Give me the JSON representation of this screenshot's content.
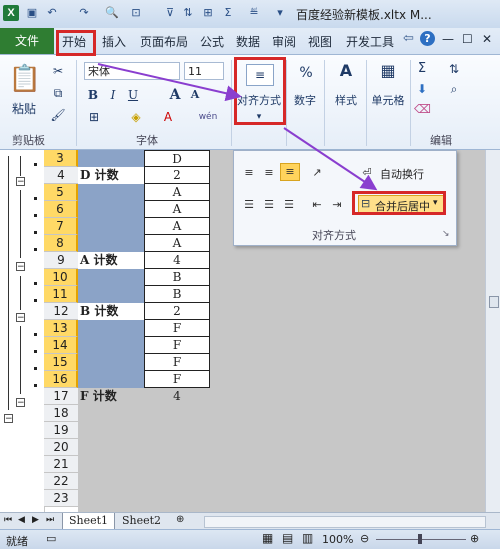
{
  "window": {
    "title": "百度经验新模板.xltx M...",
    "app_logo": "X",
    "controls": [
      "—",
      "☐",
      "✕"
    ]
  },
  "tabs": [
    "文件",
    "开始",
    "插入",
    "页面布局",
    "公式",
    "数据",
    "审阅",
    "视图",
    "开发工具"
  ],
  "ribbon": {
    "clipboard": {
      "paste_label": "粘贴",
      "group_label": "剪贴板"
    },
    "font": {
      "name": "宋体",
      "size": "11",
      "bold": "B",
      "italic": "I",
      "underline": "U",
      "grow": "A",
      "shrink": "A",
      "group_label": "字体",
      "wen": "wén"
    },
    "alignment": {
      "label": "对齐方式"
    },
    "number": {
      "icon": "%",
      "label": "数字"
    },
    "styles": {
      "label": "样式"
    },
    "cells": {
      "label": "单元格"
    },
    "editing": {
      "sigma": "Σ",
      "label": "编辑"
    }
  },
  "align_popup": {
    "wrap_text": "自动换行",
    "merge_center": "合并后居中",
    "group_label": "对齐方式"
  },
  "rows": [
    {
      "num": "3",
      "a": "",
      "b": "D",
      "type": "item"
    },
    {
      "num": "4",
      "a": "D 计数",
      "b": "2",
      "type": "sum"
    },
    {
      "num": "5",
      "a": "",
      "b": "A",
      "type": "item"
    },
    {
      "num": "6",
      "a": "",
      "b": "A",
      "type": "item"
    },
    {
      "num": "7",
      "a": "",
      "b": "A",
      "type": "item"
    },
    {
      "num": "8",
      "a": "",
      "b": "A",
      "type": "item"
    },
    {
      "num": "9",
      "a": "A 计数",
      "b": "4",
      "type": "sum"
    },
    {
      "num": "10",
      "a": "",
      "b": "B",
      "type": "item"
    },
    {
      "num": "11",
      "a": "",
      "b": "B",
      "type": "item"
    },
    {
      "num": "12",
      "a": "B 计数",
      "b": "2",
      "type": "sum"
    },
    {
      "num": "13",
      "a": "",
      "b": "F",
      "type": "item"
    },
    {
      "num": "14",
      "a": "",
      "b": "F",
      "type": "item"
    },
    {
      "num": "15",
      "a": "",
      "b": "F",
      "type": "item"
    },
    {
      "num": "16",
      "a": "",
      "b": "F",
      "type": "item"
    },
    {
      "num": "17",
      "a": "F 计数",
      "b": "4",
      "type": "total"
    },
    {
      "num": "18",
      "a": "",
      "b": "",
      "type": "empty"
    },
    {
      "num": "19",
      "a": "",
      "b": "",
      "type": "empty"
    },
    {
      "num": "20",
      "a": "",
      "b": "",
      "type": "empty"
    },
    {
      "num": "21",
      "a": "",
      "b": "",
      "type": "empty"
    },
    {
      "num": "22",
      "a": "",
      "b": "",
      "type": "empty"
    },
    {
      "num": "23",
      "a": "",
      "b": "",
      "type": "empty"
    }
  ],
  "sheets": [
    "Sheet1",
    "Sheet2"
  ],
  "status": {
    "ready": "就绪",
    "zoom": "100%"
  },
  "colors": {
    "accent_highlight": "#d62828",
    "arrow": "#8a3ecf",
    "file_tab": "#2f7d32",
    "selected_rows": "#ffd966"
  }
}
